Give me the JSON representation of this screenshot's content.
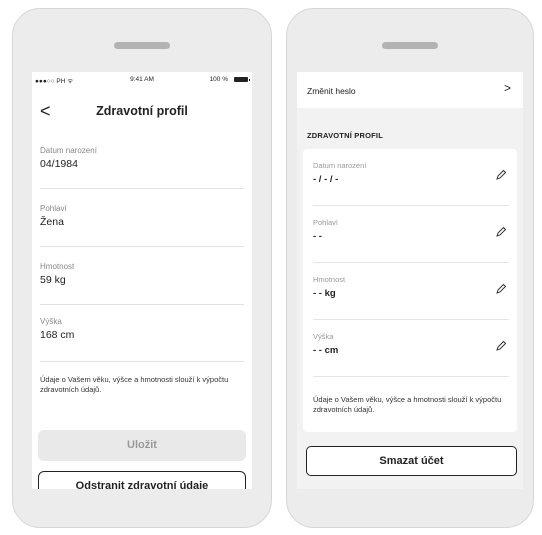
{
  "left_phone": {
    "status": {
      "carrier": "●●●○○ PH ᯤ",
      "time": "9:41 AM",
      "battery": "100 %"
    },
    "nav": {
      "back_glyph": "<",
      "title": "Zdravotní profil"
    },
    "fields": [
      {
        "label": "Datum narození",
        "value": "04/1984"
      },
      {
        "label": "Pohlaví",
        "value": "Žena"
      },
      {
        "label": "Hmotnost",
        "value": "59 kg"
      },
      {
        "label": "Výška",
        "value": "168 cm"
      }
    ],
    "note": "Údaje o Vašem věku, výšce a hmotnosti slouží k výpočtu zdravotních údajů.",
    "save_label": "Uložit",
    "remove_label": "Odstranit zdravotní údaje"
  },
  "right_phone": {
    "change_password": "Změnit heslo",
    "chevron": ">",
    "section_title": "ZDRAVOTNÍ PROFIL",
    "fields": [
      {
        "label": "Datum narození",
        "value": "- / - / -"
      },
      {
        "label": "Pohlaví",
        "value": "- -"
      },
      {
        "label": "Hmotnost",
        "value": "- - kg"
      },
      {
        "label": "Výška",
        "value": "- - cm"
      }
    ],
    "note": "Údaje o Vašem věku, výšce a hmotnosti slouží k výpočtu zdravotních údajů.",
    "delete_label": "Smazat účet"
  }
}
